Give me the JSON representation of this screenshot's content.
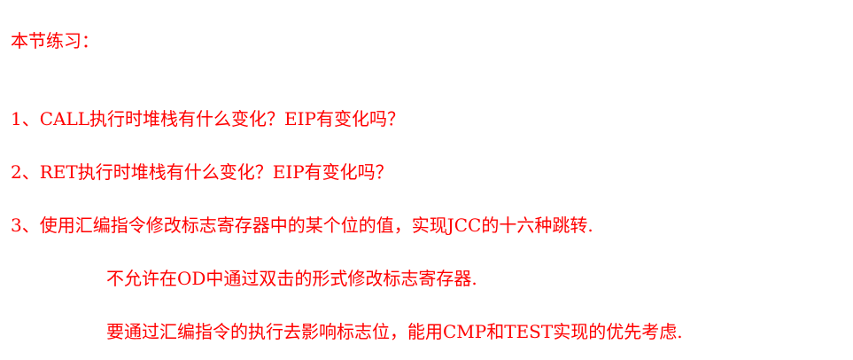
{
  "section": {
    "title": "本节练习：",
    "questions": [
      "1、CALL执行时堆栈有什么变化？EIP有变化吗？",
      "2、RET执行时堆栈有什么变化？EIP有变化吗？",
      "3、使用汇编指令修改标志寄存器中的某个位的值，实现JCC的十六种跳转."
    ],
    "notes": [
      "不允许在OD中通过双击的形式修改标志寄存器.",
      "要通过汇编指令的执行去影响标志位，能用CMP和TEST实现的优先考虑."
    ]
  },
  "colors": {
    "text": "#ff0000",
    "background": "#ffffff"
  }
}
